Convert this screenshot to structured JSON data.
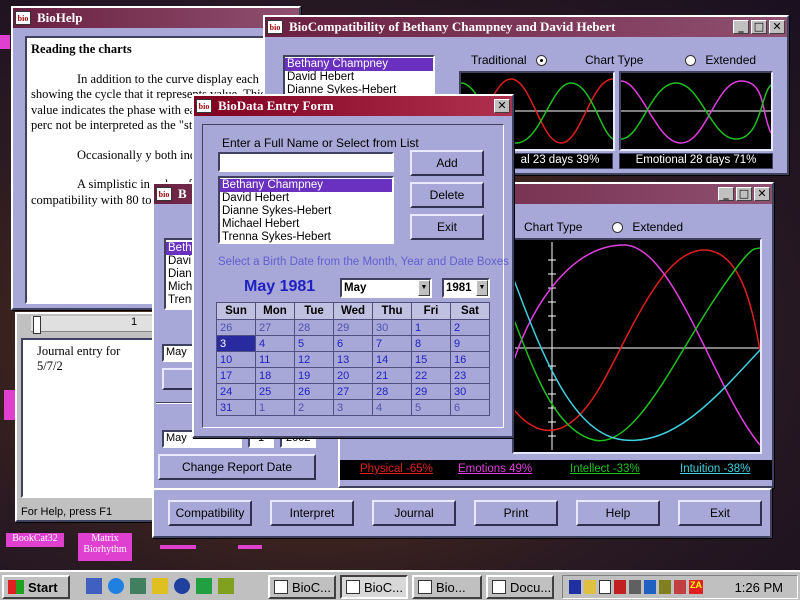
{
  "desktop": {
    "icons": [
      "BookCat32",
      "Matrix Biorhythm"
    ]
  },
  "biohelp": {
    "title": "BioHelp",
    "heading": "Reading the charts",
    "paragraphs": [
      "In addition to the curve display each showing the cycle that it represents value. This value indicates the phase with each other as a perc not be interpreted as the \"stren charted.",
      "Occasionally y both individuals are tot",
      "A simplistic in values from 0 to 20% in compatibility with 80 to"
    ]
  },
  "bio_b": {
    "title_fragment": "B",
    "list": [
      "Beth",
      "Davi",
      "Dian",
      "Mich",
      "Tren"
    ],
    "ruler_mark": "1",
    "journal_text": "Journal entry for 5/7/2",
    "month_combo": "May",
    "month2": "May",
    "day2": "1",
    "year2": "2002",
    "change_report": "Change Report Date",
    "status": "For Help, press F1"
  },
  "compat": {
    "title": "BioCompatibility of Bethany Champney and David Hebert",
    "list": [
      "Bethany Champney",
      "David Hebert",
      "Dianne Sykes-Hebert"
    ],
    "traditional": "Traditional",
    "chart_type": "Chart Type",
    "extended": "Extended",
    "caption1": "al 23 days 39%",
    "caption2": "Emotional 28 days 71%"
  },
  "big_chart": {
    "title_fragment": "2",
    "chart_type": "Chart Type",
    "extended": "Extended",
    "legend": [
      {
        "text": "Physical -65%",
        "color": "#e02020"
      },
      {
        "text": "Emotions 49%",
        "color": "#e040e0"
      },
      {
        "text": "Intellect -33%",
        "color": "#20c020"
      },
      {
        "text": "Intuition -38%",
        "color": "#40d0e0"
      }
    ]
  },
  "bottom_buttons": [
    "Compatibility",
    "Interpret",
    "Journal",
    "Print",
    "Help",
    "Exit"
  ],
  "entry": {
    "title": "BioData Entry Form",
    "prompt": "Enter a Full Name or Select from List",
    "name_value": "",
    "add": "Add",
    "delete": "Delete",
    "exit": "Exit",
    "names": [
      "Bethany Champney",
      "David Hebert",
      "Dianne Sykes-Hebert",
      "Michael Hebert",
      "Trenna Sykes-Hebert"
    ],
    "instruction": "Select a Birth Date from the Month, Year and Date Boxes",
    "month_year": "May 1981",
    "month_combo": "May",
    "year_combo": "1981",
    "days": [
      "Sun",
      "Mon",
      "Tue",
      "Wed",
      "Thu",
      "Fri",
      "Sat"
    ],
    "weeks": [
      [
        "26",
        "27",
        "28",
        "29",
        "30",
        "1",
        "2"
      ],
      [
        "3",
        "4",
        "5",
        "6",
        "7",
        "8",
        "9"
      ],
      [
        "10",
        "11",
        "12",
        "13",
        "14",
        "15",
        "16"
      ],
      [
        "17",
        "18",
        "19",
        "20",
        "21",
        "22",
        "23"
      ],
      [
        "24",
        "25",
        "26",
        "27",
        "28",
        "29",
        "30"
      ],
      [
        "31",
        "1",
        "2",
        "3",
        "4",
        "5",
        "6"
      ]
    ]
  },
  "taskbar": {
    "start": "Start",
    "tasks": [
      "BioC...",
      "BioC...",
      "Bio...",
      "Docu..."
    ],
    "clock": "1:26 PM"
  }
}
